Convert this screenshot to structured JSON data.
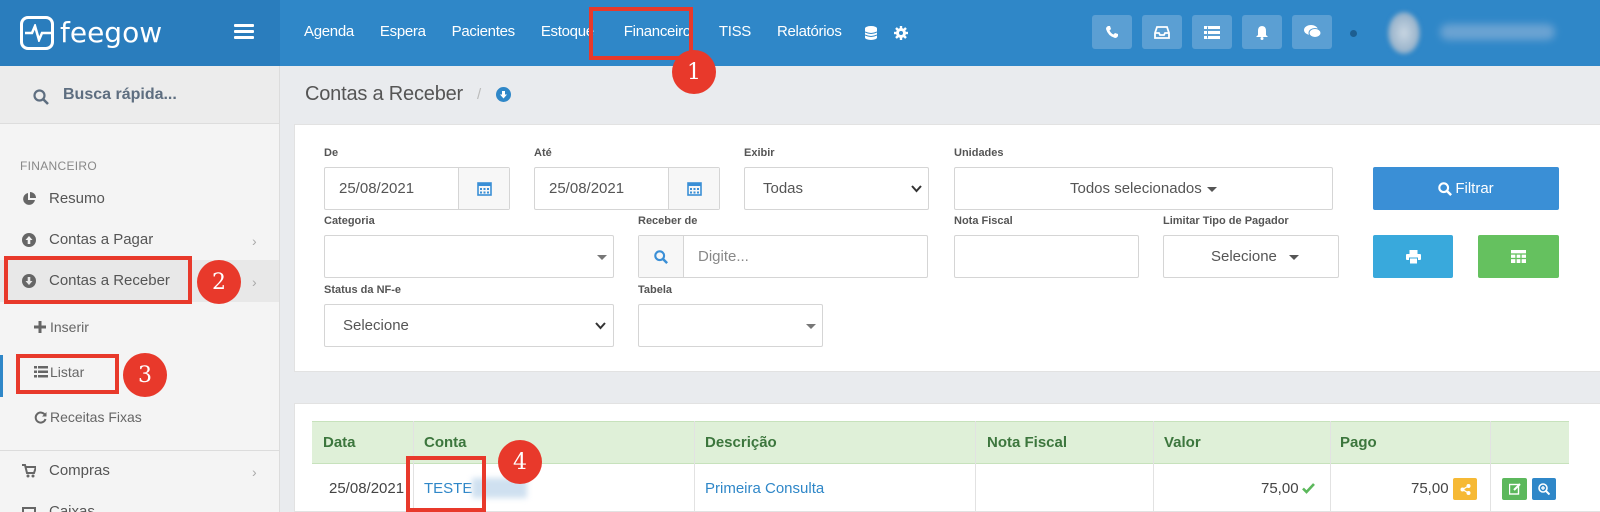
{
  "brand": {
    "name": "feegow"
  },
  "nav": {
    "items": [
      "Agenda",
      "Espera",
      "Pacientes",
      "Estoque",
      "Financeiro",
      "TISS",
      "Relatórios"
    ],
    "active": "Financeiro"
  },
  "topbar_buttons": [
    "phone-icon",
    "inbox-icon",
    "list-icon",
    "bell-icon",
    "chat-icon"
  ],
  "sidebar": {
    "search_label": "Busca rápida...",
    "section": "FINANCEIRO",
    "items": [
      {
        "label": "Resumo",
        "icon": "pie-chart-icon"
      },
      {
        "label": "Contas a Pagar",
        "icon": "arrow-up-circle-icon"
      },
      {
        "label": "Contas a Receber",
        "icon": "arrow-down-circle-icon"
      }
    ],
    "sub_items": [
      {
        "label": "Inserir",
        "icon": "plus-icon"
      },
      {
        "label": "Listar",
        "icon": "list-icon"
      },
      {
        "label": "Receitas Fixas",
        "icon": "refresh-icon"
      }
    ],
    "bottom_items": [
      {
        "label": "Compras",
        "icon": "cart-icon"
      },
      {
        "label": "Caixas",
        "icon": "box-icon"
      }
    ]
  },
  "page": {
    "title": "Contas a Receber",
    "separator": "/"
  },
  "filters": {
    "de": {
      "label": "De",
      "value": "25/08/2021"
    },
    "ate": {
      "label": "Até",
      "value": "25/08/2021"
    },
    "exibir": {
      "label": "Exibir",
      "value": "Todas"
    },
    "unidades": {
      "label": "Unidades",
      "value": "Todos selecionados"
    },
    "categoria": {
      "label": "Categoria",
      "value": ""
    },
    "receber_de": {
      "label": "Receber de",
      "placeholder": "Digite..."
    },
    "nota_fiscal": {
      "label": "Nota Fiscal",
      "value": ""
    },
    "limitar": {
      "label": "Limitar Tipo de Pagador",
      "value": "Selecione"
    },
    "status_nfe": {
      "label": "Status da NF-e",
      "value": "Selecione"
    },
    "tabela": {
      "label": "Tabela",
      "value": ""
    },
    "filter_button": "Filtrar"
  },
  "colors": {
    "primary": "#2f87c8",
    "filter_btn": "#3a8fd6",
    "print_btn": "#39a9dc",
    "excel_btn": "#65c15f",
    "highlight": "#e8392b"
  },
  "table": {
    "columns": [
      "Data",
      "Conta",
      "Descrição",
      "Nota Fiscal",
      "Valor",
      "Pago"
    ],
    "rows": [
      {
        "data": "25/08/2021",
        "conta": "TESTE",
        "descricao": "Primeira Consulta",
        "nota_fiscal": "",
        "valor": "75,00",
        "pago": "75,00"
      }
    ]
  },
  "annotations": [
    "1",
    "2",
    "3",
    "4"
  ]
}
